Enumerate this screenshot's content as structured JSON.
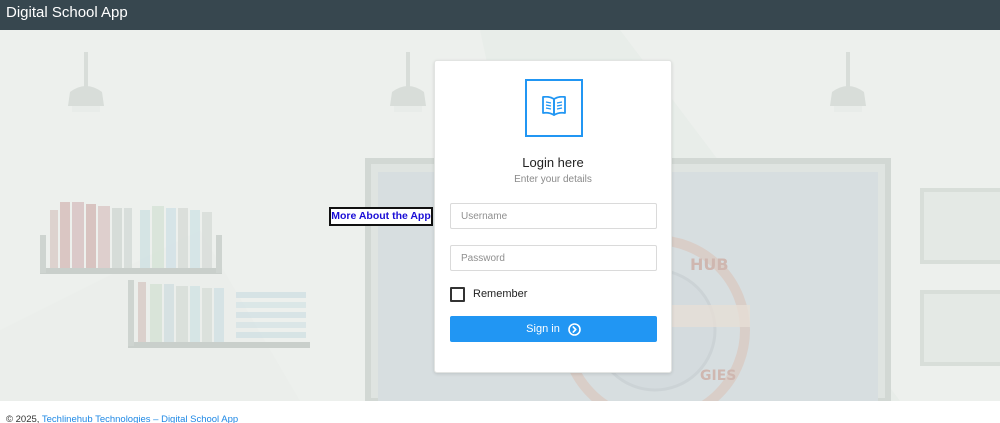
{
  "header": {
    "title": "Digital School App"
  },
  "side_link": {
    "label": "More About the App"
  },
  "login": {
    "title": "Login here",
    "subtitle": "Enter your details",
    "username_placeholder": "Username",
    "password_placeholder": "Password",
    "remember_label": "Remember",
    "signin_label": "Sign in"
  },
  "footer": {
    "copyright": "© 2025,",
    "link_text": "Techlinehub Technologies – Digital School App"
  },
  "icons": {
    "logo": "open-book-icon",
    "signin_arrow": "circle-chevron-right-icon"
  },
  "colors": {
    "header": "#37474f",
    "accent": "#2196f3",
    "link": "#1e88e5"
  }
}
